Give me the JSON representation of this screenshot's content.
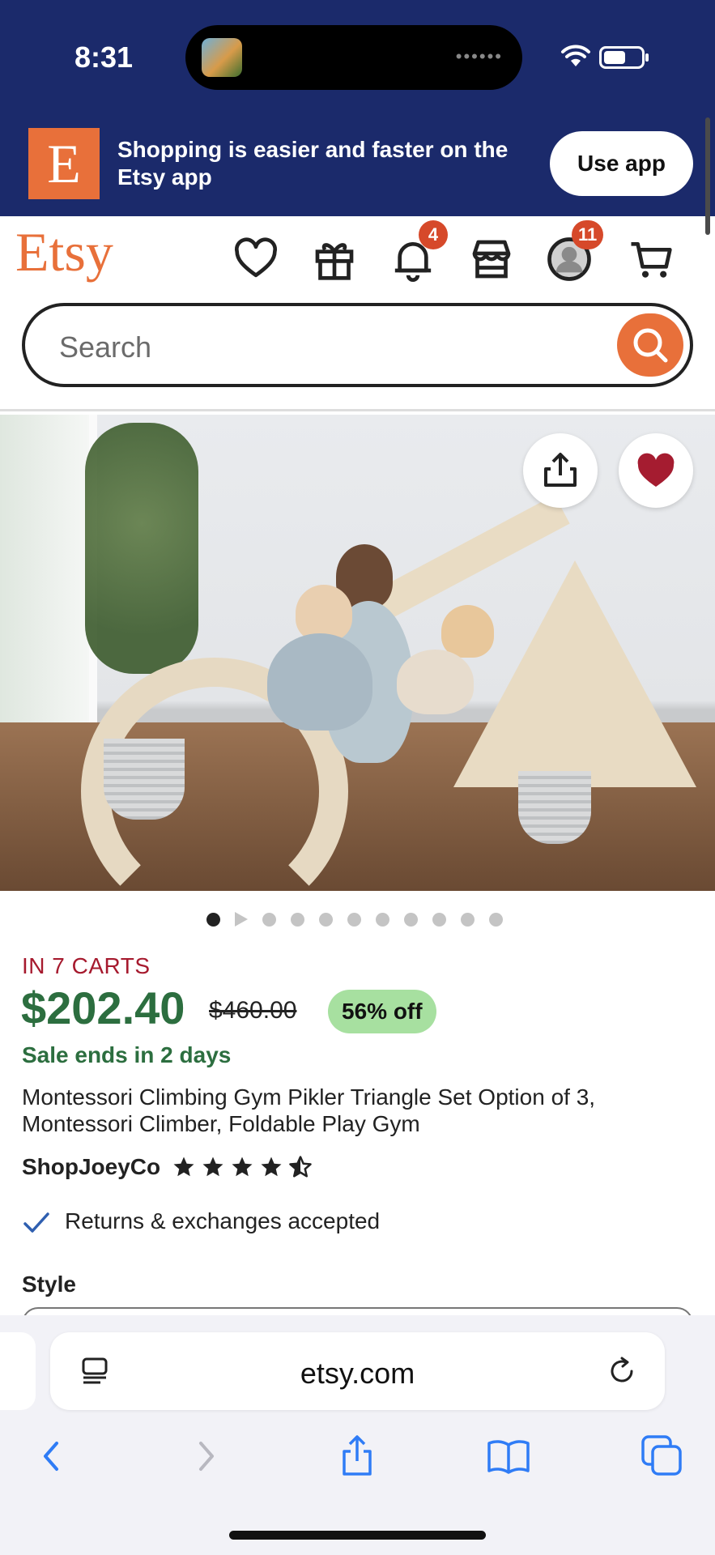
{
  "status_bar": {
    "time": "8:31"
  },
  "app_banner": {
    "logo_letter": "E",
    "message": "Shopping is easier and faster on the Etsy app",
    "button_label": "Use app"
  },
  "header": {
    "logo": "Etsy",
    "notifications_count": "4",
    "account_count": "11",
    "icons": [
      "heart-icon",
      "gift-icon",
      "bell-icon",
      "shop-icon",
      "account-icon",
      "cart-icon"
    ]
  },
  "search": {
    "placeholder": "Search"
  },
  "carousel": {
    "total_slides": 11,
    "active_index": 0
  },
  "product": {
    "in_carts": "IN 7 CARTS",
    "price": "$202.40",
    "original_price": "$460.00",
    "discount": "56% off",
    "sale_ends": "Sale ends in 2 days",
    "title": "Montessori Climbing Gym Pikler Triangle Set Option of 3, Montessori Climber, Foldable Play Gym",
    "shop_name": "ShopJoeyCo",
    "rating": 4.5,
    "returns": "Returns & exchanges accepted",
    "style_label": "Style"
  },
  "safari": {
    "url": "etsy.com"
  },
  "colors": {
    "banner_bg": "#1b2a6b",
    "etsy_orange": "#e8703a",
    "price_green": "#2c6e3f",
    "cart_red": "#a61a2e",
    "discount_bg": "#a7e0a0",
    "badge_red": "#d6492a",
    "favorite_red": "#a51c30",
    "safari_blue": "#2f7cf6"
  }
}
